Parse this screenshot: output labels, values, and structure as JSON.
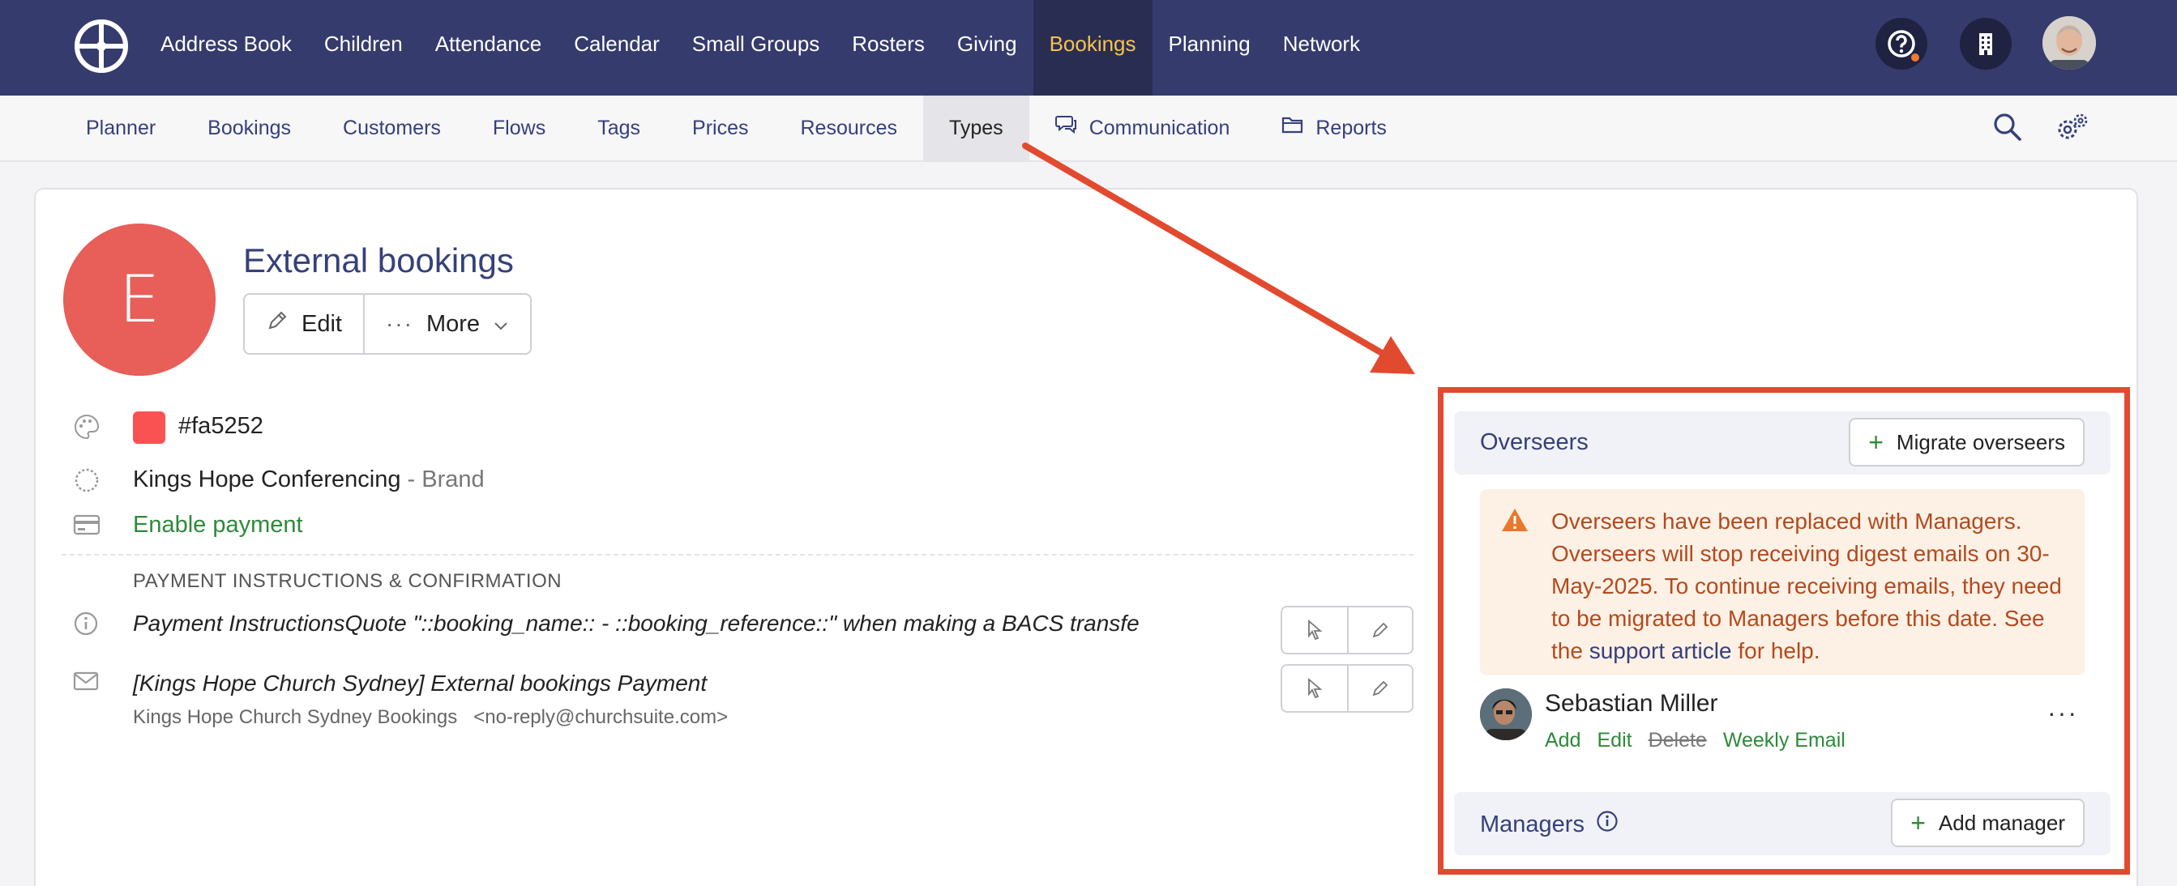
{
  "topnav": {
    "items": [
      {
        "label": "Address Book"
      },
      {
        "label": "Children"
      },
      {
        "label": "Attendance"
      },
      {
        "label": "Calendar"
      },
      {
        "label": "Small Groups"
      },
      {
        "label": "Rosters"
      },
      {
        "label": "Giving"
      },
      {
        "label": "Bookings",
        "active": true
      },
      {
        "label": "Planning"
      },
      {
        "label": "Network"
      }
    ],
    "icons": [
      "help-icon",
      "building-icon",
      "avatar"
    ]
  },
  "subnav": {
    "items": [
      {
        "label": "Planner"
      },
      {
        "label": "Bookings"
      },
      {
        "label": "Customers"
      },
      {
        "label": "Flows"
      },
      {
        "label": "Tags"
      },
      {
        "label": "Prices"
      },
      {
        "label": "Resources"
      },
      {
        "label": "Types",
        "active": true
      },
      {
        "label": "Communication",
        "icon": "chat-icon"
      },
      {
        "label": "Reports",
        "icon": "folder-icon"
      }
    ]
  },
  "record": {
    "avatar_letter": "E",
    "title": "External bookings",
    "edit_label": "Edit",
    "more_label": "More",
    "color_hex": "#fa5252",
    "brand_name": "Kings Hope Conferencing",
    "brand_suffix": "- Brand",
    "enable_payment": "Enable payment",
    "section_heading": "PAYMENT INSTRUCTIONS & CONFIRMATION",
    "payment_instructions": "Payment InstructionsQuote \"::booking_name:: - ::booking_reference::\" when making a BACS transfe",
    "email_subject": "[Kings Hope Church Sydney] External bookings Payment",
    "email_from_name": "Kings Hope Church Sydney Bookings",
    "email_from_address": "<no-reply@churchsuite.com>"
  },
  "overseers": {
    "title": "Overseers",
    "migrate_label": "Migrate overseers",
    "warning_pre": "Overseers have been replaced with Managers. Overseers will stop receiving digest emails on 30-May-2025. To continue receiving emails, they need to be migrated to Managers before this date. See the ",
    "warning_link": "support article",
    "warning_post": " for help.",
    "person": {
      "name": "Sebastian Miller",
      "actions": {
        "add": "Add",
        "edit": "Edit",
        "delete": "Delete",
        "weekly": "Weekly Email"
      }
    }
  },
  "managers": {
    "title": "Managers",
    "add_label": "Add manager"
  },
  "colors": {
    "nav_bg": "#363b6d",
    "active_nav": "#f5c34d",
    "avatar_bg": "#e85e58",
    "highlight": "#e24a2f",
    "green": "#2e8a3a"
  }
}
